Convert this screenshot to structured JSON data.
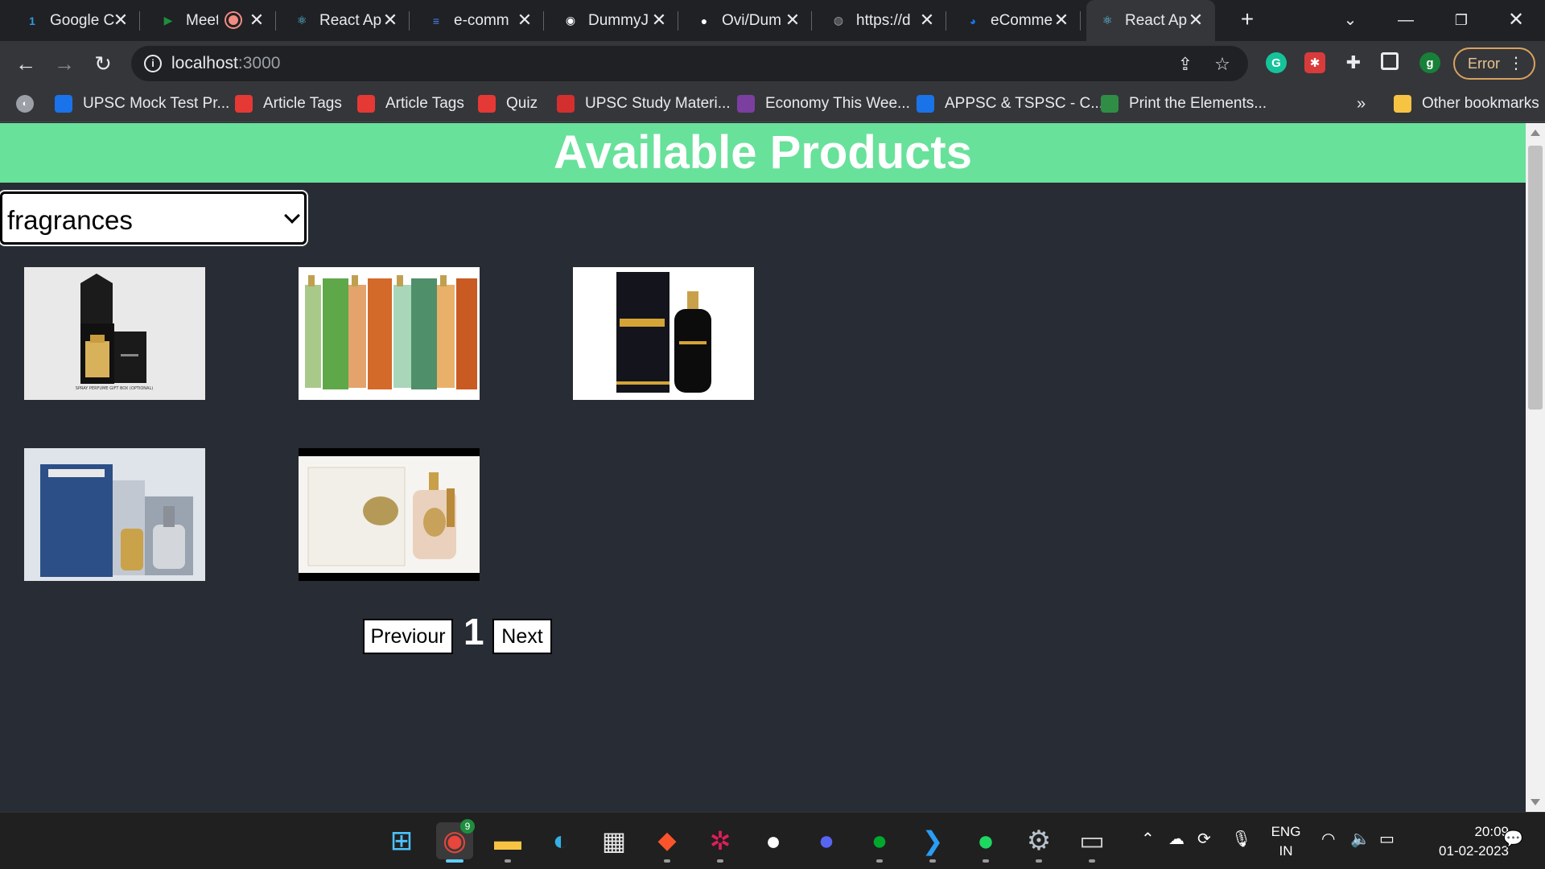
{
  "browser": {
    "tabs": [
      {
        "title": "Google C",
        "icon": "google-sheets-icon",
        "color": "#2d9cdb",
        "glyph": "1"
      },
      {
        "title": "Meet",
        "icon": "google-meet-icon",
        "color": "#1e8e3e",
        "glyph": "▶",
        "recording": true
      },
      {
        "title": "React Ap",
        "icon": "react-icon",
        "color": "#61dafb",
        "glyph": "⚛"
      },
      {
        "title": "e-comm",
        "icon": "google-docs-icon",
        "color": "#4285f4",
        "glyph": "≡"
      },
      {
        "title": "DummyJ",
        "icon": "dummyjson-icon",
        "color": "#ffffff",
        "glyph": "◉"
      },
      {
        "title": "Ovi/Dum",
        "icon": "github-icon",
        "color": "#ffffff",
        "glyph": "●"
      },
      {
        "title": "https://d",
        "icon": "globe-icon",
        "color": "#9aa0a6",
        "glyph": "◍"
      },
      {
        "title": "eComme",
        "icon": "ecommerce-icon",
        "color": "#1a73e8",
        "glyph": "◕"
      },
      {
        "title": "React Ap",
        "icon": "react-icon",
        "color": "#61dafb",
        "glyph": "⚛",
        "active": true
      }
    ],
    "url_host": "localhost",
    "url_port": ":3000",
    "error_label": "Error",
    "profile_initial": "g",
    "bookmarks": [
      {
        "label": "UPSC Mock Test Pr...",
        "icon": "testbook-icon",
        "color": "#1a73e8"
      },
      {
        "label": "Article Tags",
        "icon": "article-tags-icon",
        "color": "#e53935"
      },
      {
        "label": "Article Tags",
        "icon": "article-tags-icon",
        "color": "#e53935"
      },
      {
        "label": "Quiz",
        "icon": "quiz-icon",
        "color": "#e53935"
      },
      {
        "label": "UPSC Study Materi...",
        "icon": "upsc-study-icon",
        "color": "#d32f2f"
      },
      {
        "label": "Economy This Wee...",
        "icon": "economy-icon",
        "color": "#7b3fa0"
      },
      {
        "label": "APPSC & TSPSC - C...",
        "icon": "testbook-icon",
        "color": "#1a73e8"
      },
      {
        "label": "Print the Elements...",
        "icon": "geeksforgeeks-icon",
        "color": "#2f8d46"
      }
    ],
    "overflow_label": "»",
    "other_bookmarks": "Other bookmarks"
  },
  "page": {
    "title": "Available Products",
    "category_selected": "fragrances",
    "products": [
      {
        "name": "perfume-gift-box",
        "caption": "SPRAY PERFUME GIFT BOX (OPTIONAL)"
      },
      {
        "name": "attar-collection"
      },
      {
        "name": "fogg-perfume"
      },
      {
        "name": "musk-mahal-perfume"
      },
      {
        "name": "al-qaseer-perfume"
      }
    ],
    "pagination": {
      "previous": "Previour",
      "page": "1",
      "next": "Next"
    }
  },
  "taskbar": {
    "apps": [
      "windows-start-icon",
      "chrome-icon",
      "file-explorer-icon",
      "edge-icon",
      "microsoft-store-icon",
      "brave-icon",
      "slack-icon",
      "testbook-icon",
      "discord-icon",
      "evernote-icon",
      "vscode-icon",
      "spotify-icon",
      "settings-icon",
      "terminal-icon"
    ],
    "chrome_badge": "9",
    "lang_top": "ENG",
    "lang_bottom": "IN",
    "time": "20:09",
    "date": "01-02-2023"
  }
}
